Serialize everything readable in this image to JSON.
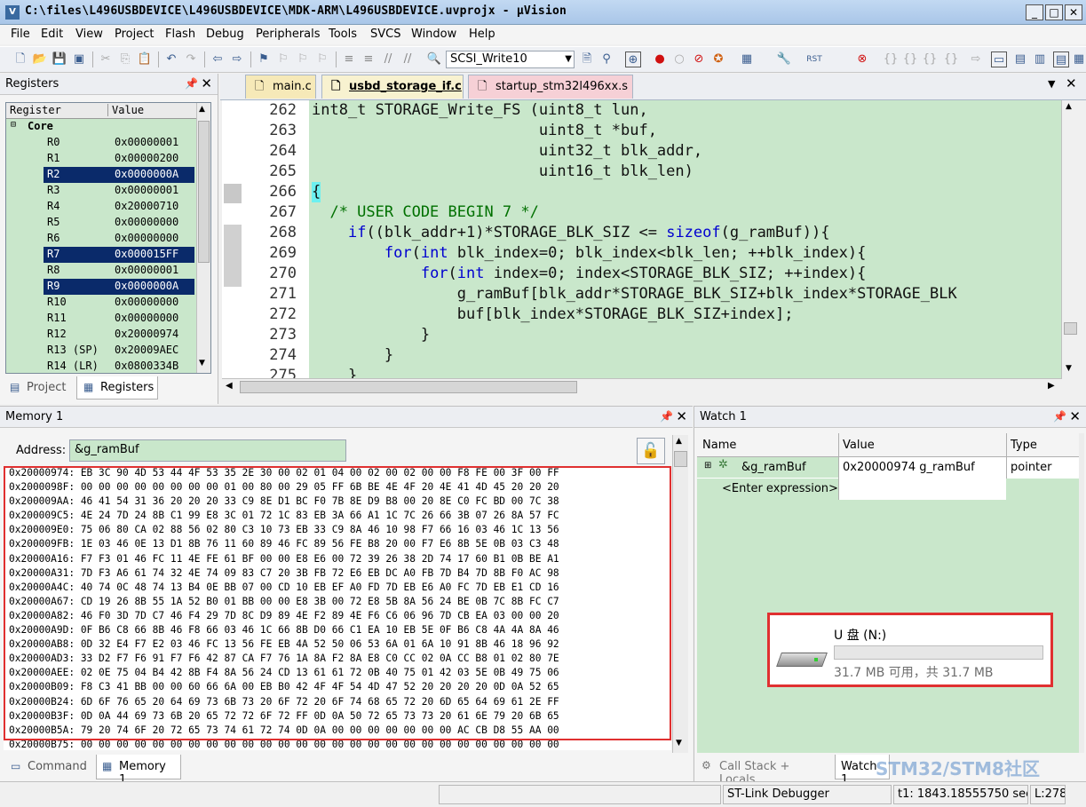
{
  "window": {
    "title": "C:\\files\\L496USBDEVICE\\L496USBDEVICE\\MDK-ARM\\L496USBDEVICE.uvprojx - µVision",
    "icon_label": "V"
  },
  "menu": [
    "File",
    "Edit",
    "View",
    "Project",
    "Flash",
    "Debug",
    "Peripherals",
    "Tools",
    "SVCS",
    "Window",
    "Help"
  ],
  "toolbar": {
    "target": "SCSI_Write10"
  },
  "registers_panel": {
    "title": "Registers",
    "col_register": "Register",
    "col_value": "Value",
    "group": "Core",
    "rows": [
      {
        "name": "R0",
        "value": "0x00000001",
        "selected": false
      },
      {
        "name": "R1",
        "value": "0x00000200",
        "selected": false
      },
      {
        "name": "R2",
        "value": "0x0000000A",
        "selected": true
      },
      {
        "name": "R3",
        "value": "0x00000001",
        "selected": false
      },
      {
        "name": "R4",
        "value": "0x20000710",
        "selected": false
      },
      {
        "name": "R5",
        "value": "0x00000000",
        "selected": false
      },
      {
        "name": "R6",
        "value": "0x00000000",
        "selected": false
      },
      {
        "name": "R7",
        "value": "0x000015FF",
        "selected": true
      },
      {
        "name": "R8",
        "value": "0x00000001",
        "selected": false
      },
      {
        "name": "R9",
        "value": "0x0000000A",
        "selected": true
      },
      {
        "name": "R10",
        "value": "0x00000000",
        "selected": false
      },
      {
        "name": "R11",
        "value": "0x00000000",
        "selected": false
      },
      {
        "name": "R12",
        "value": "0x20000974",
        "selected": false
      },
      {
        "name": "R13 (SP)",
        "value": "0x20009AEC",
        "selected": false
      },
      {
        "name": "R14 (LR)",
        "value": "0x0800334B",
        "selected": false
      }
    ],
    "tabs": [
      "Project",
      "Registers"
    ]
  },
  "editor": {
    "tabs": [
      "main.c",
      "usbd_storage_if.c",
      "startup_stm32l496xx.s"
    ],
    "lines": [
      {
        "n": "262",
        "text": "int8_t STORAGE_Write_FS (uint8_t lun,"
      },
      {
        "n": "263",
        "text": "                         uint8_t *buf,"
      },
      {
        "n": "264",
        "text": "                         uint32_t blk_addr,"
      },
      {
        "n": "265",
        "text": "                         uint16_t blk_len)"
      },
      {
        "n": "266",
        "text": "{"
      },
      {
        "n": "267",
        "text": "  /* USER CODE BEGIN 7 */"
      },
      {
        "n": "268",
        "text": "    if((blk_addr+1)*STORAGE_BLK_SIZ <= sizeof(g_ramBuf)){"
      },
      {
        "n": "269",
        "text": "        for(int blk_index=0; blk_index<blk_len; ++blk_index){"
      },
      {
        "n": "270",
        "text": "            for(int index=0; index<STORAGE_BLK_SIZ; ++index){"
      },
      {
        "n": "271",
        "text": "                g_ramBuf[blk_addr*STORAGE_BLK_SIZ+blk_index*STORAGE_BLK"
      },
      {
        "n": "272",
        "text": "                buf[blk_index*STORAGE_BLK_SIZ+index];"
      },
      {
        "n": "273",
        "text": "            }"
      },
      {
        "n": "274",
        "text": "        }"
      },
      {
        "n": "275",
        "text": "    }"
      }
    ]
  },
  "memory_panel": {
    "title": "Memory 1",
    "address_label": "Address:",
    "address_value": "&g_ramBuf",
    "rows": [
      "0x20000974: EB 3C 90 4D 53 44 4F 53 35 2E 30 00 02 01 04 00 02 00 02 00 00 F8 FE 00 3F 00 FF",
      "0x2000098F: 00 00 00 00 00 00 00 00 01 00 80 00 29 05 FF 6B BE 4E 4F 20 4E 41 4D 45 20 20 20",
      "0x200009AA: 46 41 54 31 36 20 20 20 33 C9 8E D1 BC F0 7B 8E D9 B8 00 20 8E C0 FC BD 00 7C 38",
      "0x200009C5: 4E 24 7D 24 8B C1 99 E8 3C 01 72 1C 83 EB 3A 66 A1 1C 7C 26 66 3B 07 26 8A 57 FC",
      "0x200009E0: 75 06 80 CA 02 88 56 02 80 C3 10 73 EB 33 C9 8A 46 10 98 F7 66 16 03 46 1C 13 56",
      "0x200009FB: 1E 03 46 0E 13 D1 8B 76 11 60 89 46 FC 89 56 FE B8 20 00 F7 E6 8B 5E 0B 03 C3 48",
      "0x20000A16: F7 F3 01 46 FC 11 4E FE 61 BF 00 00 E8 E6 00 72 39 26 38 2D 74 17 60 B1 0B BE A1",
      "0x20000A31: 7D F3 A6 61 74 32 4E 74 09 83 C7 20 3B FB 72 E6 EB DC A0 FB 7D B4 7D 8B F0 AC 98",
      "0x20000A4C: 40 74 0C 48 74 13 B4 0E BB 07 00 CD 10 EB EF A0 FD 7D EB E6 A0 FC 7D EB E1 CD 16",
      "0x20000A67: CD 19 26 8B 55 1A 52 B0 01 BB 00 00 E8 3B 00 72 E8 5B 8A 56 24 BE 0B 7C 8B FC C7",
      "0x20000A82: 46 F0 3D 7D C7 46 F4 29 7D 8C D9 89 4E F2 89 4E F6 C6 06 96 7D CB EA 03 00 00 20",
      "0x20000A9D: 0F B6 C8 66 8B 46 F8 66 03 46 1C 66 8B D0 66 C1 EA 10 EB 5E 0F B6 C8 4A 4A 8A 46",
      "0x20000AB8: 0D 32 E4 F7 E2 03 46 FC 13 56 FE EB 4A 52 50 06 53 6A 01 6A 10 91 8B 46 18 96 92",
      "0x20000AD3: 33 D2 F7 F6 91 F7 F6 42 87 CA F7 76 1A 8A F2 8A E8 C0 CC 02 0A CC B8 01 02 80 7E",
      "0x20000AEE: 02 0E 75 04 B4 42 8B F4 8A 56 24 CD 13 61 61 72 0B 40 75 01 42 03 5E 0B 49 75 06",
      "0x20000B09: F8 C3 41 BB 00 00 60 66 6A 00 EB B0 42 4F 4F 54 4D 47 52 20 20 20 20 0D 0A 52 65",
      "0x20000B24: 6D 6F 76 65 20 64 69 73 6B 73 20 6F 72 20 6F 74 68 65 72 20 6D 65 64 69 61 2E FF",
      "0x20000B3F: 0D 0A 44 69 73 6B 20 65 72 72 6F 72 FF 0D 0A 50 72 65 73 73 20 61 6E 79 20 6B 65",
      "0x20000B5A: 79 20 74 6F 20 72 65 73 74 61 72 74 0D 0A 00 00 00 00 00 00 00 AC CB D8 55 AA 00",
      "0x20000B75: 00 00 00 00 00 00 00 00 00 00 00 00 00 00 00 00 00 00 00 00 00 00 00 00 00 00 00"
    ],
    "tabs": [
      "Command",
      "Memory 1"
    ]
  },
  "watch_panel": {
    "title": "Watch 1",
    "col_name": "Name",
    "col_value": "Value",
    "col_type": "Type",
    "row_name": "&g_ramBuf",
    "row_value": "0x20000974 g_ramBuf",
    "row_type": "pointer",
    "enter_expr": "<Enter expression>",
    "tabs": [
      "Call Stack + Locals",
      "Watch 1"
    ]
  },
  "drive": {
    "label": "U 盘 (N:)",
    "space": "31.7 MB 可用，共 31.7 MB",
    "fill_fraction": 0.0
  },
  "status": {
    "debugger": "ST-Link Debugger",
    "time": "t1: 1843.18555750 sec",
    "line": "L:278"
  },
  "watermark": "STM32/STM8社区"
}
